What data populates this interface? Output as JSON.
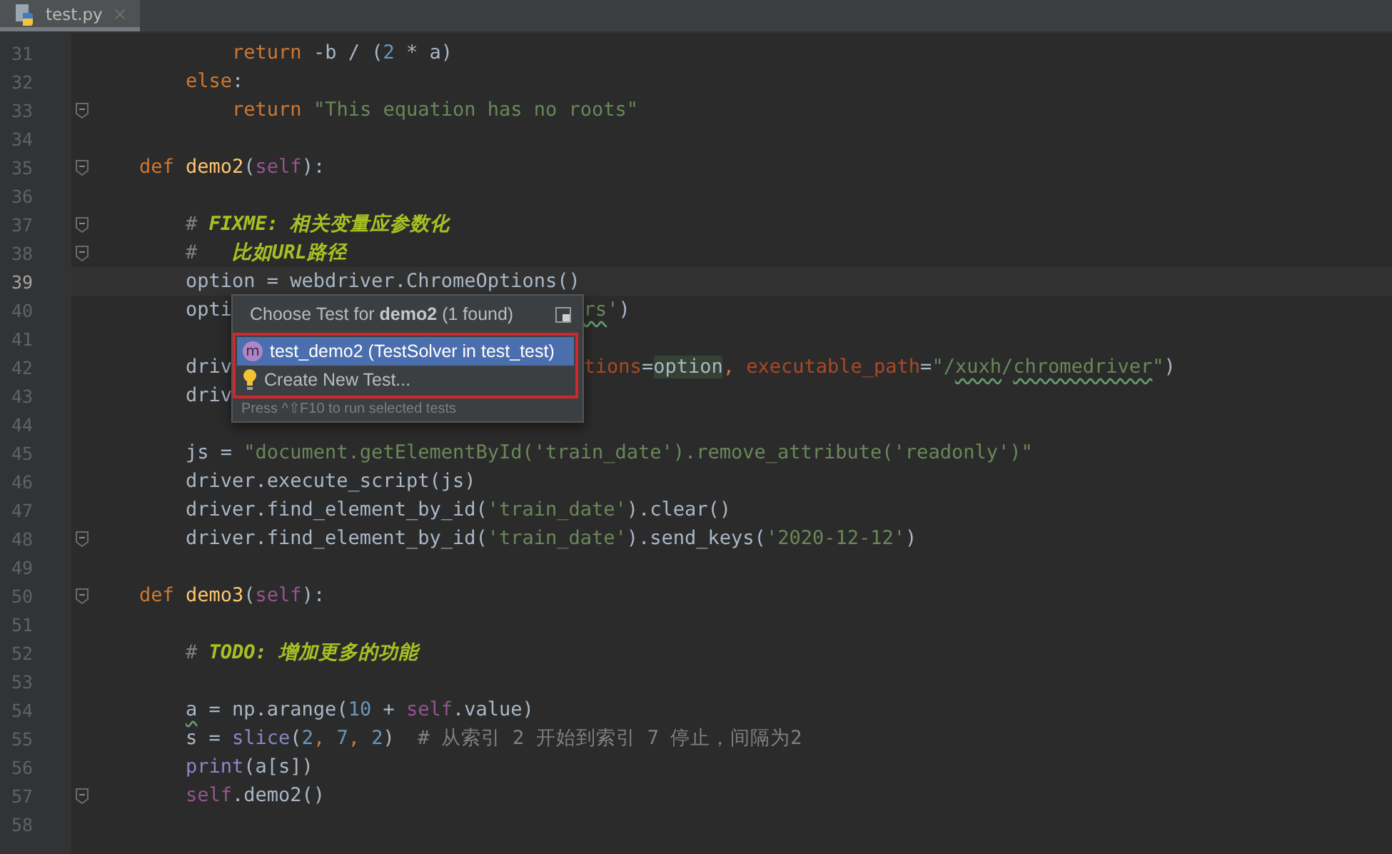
{
  "tabs": [
    {
      "label": "test.py",
      "selected": true
    }
  ],
  "lines": [
    {
      "number": "31",
      "kind": "nested",
      "current": false,
      "fold": false,
      "tokens": [
        {
          "t": "return",
          "kind": "kw"
        },
        {
          "t": " -b / (",
          "kind": "plain"
        },
        {
          "t": "2",
          "kind": "num"
        },
        {
          "t": " * a)",
          "kind": "plain"
        }
      ]
    },
    {
      "number": "32",
      "kind": "body",
      "current": false,
      "fold": false,
      "tokens": [
        {
          "t": "else",
          "kind": "kw"
        },
        {
          "t": ":",
          "kind": "plain"
        }
      ]
    },
    {
      "number": "33",
      "kind": "nested",
      "current": false,
      "fold": true,
      "tokens": [
        {
          "t": "return ",
          "kind": "kw"
        },
        {
          "t": "\"This equation has no roots\"",
          "kind": "str"
        }
      ]
    },
    {
      "number": "34",
      "kind": "blank",
      "current": false,
      "fold": false
    },
    {
      "number": "35",
      "kind": "def",
      "current": false,
      "fold": true,
      "tokens": [
        {
          "t": "def ",
          "kind": "kw"
        },
        {
          "t": "demo2",
          "kind": "fn"
        },
        {
          "t": "(",
          "kind": "plain"
        },
        {
          "t": "self",
          "kind": "self"
        },
        {
          "t": "):",
          "kind": "plain"
        }
      ]
    },
    {
      "number": "36",
      "kind": "blank",
      "current": false,
      "fold": false
    },
    {
      "number": "37",
      "kind": "body",
      "current": false,
      "fold": true,
      "tokens": [
        {
          "t": "# ",
          "kind": "comment"
        },
        {
          "t": "FIXME: 相关变量应参数化",
          "kind": "todo"
        }
      ]
    },
    {
      "number": "38",
      "kind": "body",
      "current": false,
      "fold": true,
      "tokens": [
        {
          "t": "#   ",
          "kind": "comment"
        },
        {
          "t": "比如URL路径",
          "kind": "todo"
        }
      ]
    },
    {
      "number": "39",
      "kind": "body",
      "current": true,
      "fold": false,
      "tokens": [
        {
          "t": "option = webdriver.ChromeOptions()",
          "kind": "plain"
        }
      ]
    },
    {
      "number": "40",
      "kind": "body",
      "current": false,
      "fold": false,
      "tokens": [
        {
          "t": "opti",
          "kind": "plain"
        }
      ],
      "after_popup": [
        {
          "t": "rs",
          "kind": "str_typo"
        },
        {
          "t": "'",
          "kind": "str"
        },
        {
          "t": ")",
          "kind": "plain"
        }
      ]
    },
    {
      "number": "41",
      "kind": "blank",
      "current": false,
      "fold": false
    },
    {
      "number": "42",
      "kind": "body",
      "current": false,
      "fold": false,
      "tokens": [
        {
          "t": "driv",
          "kind": "plain"
        }
      ],
      "after_popup": [
        {
          "t": "tions",
          "kind": "param"
        },
        {
          "t": "=",
          "kind": "plain"
        },
        {
          "t": "option",
          "kind": "hl"
        },
        {
          "t": ", ",
          "kind": "kw"
        },
        {
          "t": "executable_path",
          "kind": "param"
        },
        {
          "t": "=",
          "kind": "plain"
        },
        {
          "t": "\"/",
          "kind": "str"
        },
        {
          "t": "xuxh",
          "kind": "str_typo"
        },
        {
          "t": "/",
          "kind": "str"
        },
        {
          "t": "chromedriver",
          "kind": "str_typo"
        },
        {
          "t": "\"",
          "kind": "str"
        },
        {
          "t": ")",
          "kind": "plain"
        }
      ]
    },
    {
      "number": "43",
      "kind": "body",
      "current": false,
      "fold": false,
      "tokens": [
        {
          "t": "driv",
          "kind": "plain"
        }
      ]
    },
    {
      "number": "44",
      "kind": "blank",
      "current": false,
      "fold": false
    },
    {
      "number": "45",
      "kind": "body",
      "current": false,
      "fold": false,
      "tokens": [
        {
          "t": "js = ",
          "kind": "plain"
        },
        {
          "t": "\"document.getElementById('train_date').remove_attribute('readonly')\"",
          "kind": "str"
        }
      ]
    },
    {
      "number": "46",
      "kind": "body",
      "current": false,
      "fold": false,
      "tokens": [
        {
          "t": "driver.execute_script(js)",
          "kind": "plain"
        }
      ]
    },
    {
      "number": "47",
      "kind": "body",
      "current": false,
      "fold": false,
      "tokens": [
        {
          "t": "driver.find_element_by_id(",
          "kind": "plain"
        },
        {
          "t": "'train_date'",
          "kind": "str"
        },
        {
          "t": ").clear()",
          "kind": "plain"
        }
      ]
    },
    {
      "number": "48",
      "kind": "body",
      "current": false,
      "fold": true,
      "tokens": [
        {
          "t": "driver.find_element_by_id(",
          "kind": "plain"
        },
        {
          "t": "'train_date'",
          "kind": "str"
        },
        {
          "t": ").send_keys(",
          "kind": "plain"
        },
        {
          "t": "'2020-12-12'",
          "kind": "str"
        },
        {
          "t": ")",
          "kind": "plain"
        }
      ]
    },
    {
      "number": "49",
      "kind": "blank",
      "current": false,
      "fold": false
    },
    {
      "number": "50",
      "kind": "def",
      "current": false,
      "fold": true,
      "tokens": [
        {
          "t": "def ",
          "kind": "kw"
        },
        {
          "t": "demo3",
          "kind": "fn"
        },
        {
          "t": "(",
          "kind": "plain"
        },
        {
          "t": "self",
          "kind": "self"
        },
        {
          "t": "):",
          "kind": "plain"
        }
      ]
    },
    {
      "number": "51",
      "kind": "blank",
      "current": false,
      "fold": false
    },
    {
      "number": "52",
      "kind": "body",
      "current": false,
      "fold": false,
      "tokens": [
        {
          "t": "# ",
          "kind": "comment"
        },
        {
          "t": "TODO: 增加更多的功能",
          "kind": "todo"
        }
      ]
    },
    {
      "number": "53",
      "kind": "blank",
      "current": false,
      "fold": false
    },
    {
      "number": "54",
      "kind": "body",
      "current": false,
      "fold": false,
      "tokens": [
        {
          "t": "a",
          "kind": "plain_typo"
        },
        {
          "t": " = np.arange(",
          "kind": "plain"
        },
        {
          "t": "10",
          "kind": "num"
        },
        {
          "t": " + ",
          "kind": "plain"
        },
        {
          "t": "self",
          "kind": "self"
        },
        {
          "t": ".value)",
          "kind": "plain"
        }
      ]
    },
    {
      "number": "55",
      "kind": "body",
      "current": false,
      "fold": false,
      "tokens": [
        {
          "t": "s = ",
          "kind": "plain"
        },
        {
          "t": "slice",
          "kind": "builtin"
        },
        {
          "t": "(",
          "kind": "plain"
        },
        {
          "t": "2",
          "kind": "num"
        },
        {
          "t": ", ",
          "kind": "kw"
        },
        {
          "t": "7",
          "kind": "num"
        },
        {
          "t": ", ",
          "kind": "kw"
        },
        {
          "t": "2",
          "kind": "num"
        },
        {
          "t": ")  ",
          "kind": "plain"
        },
        {
          "t": "# 从索引 2 开始到索引 7 停止，间隔为2",
          "kind": "comment"
        }
      ]
    },
    {
      "number": "56",
      "kind": "body",
      "current": false,
      "fold": false,
      "tokens": [
        {
          "t": "print",
          "kind": "builtin"
        },
        {
          "t": "(a[s])",
          "kind": "plain"
        }
      ]
    },
    {
      "number": "57",
      "kind": "body",
      "current": false,
      "fold": true,
      "tokens": [
        {
          "t": "self",
          "kind": "self"
        },
        {
          "t": ".demo2()",
          "kind": "plain"
        }
      ]
    },
    {
      "number": "58",
      "kind": "blank",
      "current": false,
      "fold": false
    }
  ],
  "popup": {
    "title": "Choose Test for **demo2** (1 found)",
    "outlined": true,
    "items": [
      {
        "kind": "test",
        "badge": "m",
        "label": "test_demo2 (TestSolver in test_test)",
        "selected": true
      },
      {
        "kind": "create",
        "label": "Create New Test...",
        "selected": false
      }
    ],
    "hint": "Press ^⇧F10 to run selected tests"
  }
}
